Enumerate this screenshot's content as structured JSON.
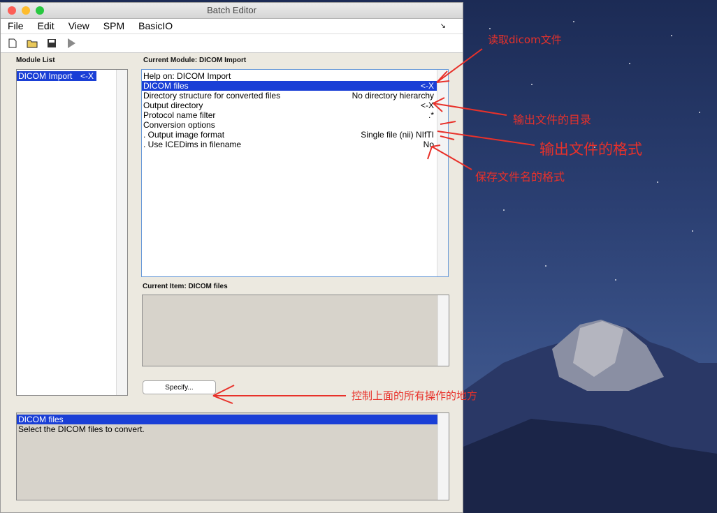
{
  "window": {
    "title": "Batch Editor"
  },
  "menu": [
    "File",
    "Edit",
    "View",
    "SPM",
    "BasicIO"
  ],
  "toolbar": {
    "icons": [
      "new-file-icon",
      "open-folder-icon",
      "save-icon",
      "run-icon"
    ]
  },
  "module_list": {
    "label": "Module List",
    "items": [
      {
        "name": "DICOM Import",
        "marker": "<-X"
      }
    ]
  },
  "current_module": {
    "label": "Current Module: DICOM Import",
    "rows": [
      {
        "name": "Help on: DICOM Import",
        "value": ""
      },
      {
        "name": "DICOM files",
        "value": "<-X"
      },
      {
        "name": "Directory structure for converted files",
        "value": "No directory hierarchy"
      },
      {
        "name": "Output directory",
        "value": "<-X"
      },
      {
        "name": "Protocol name filter",
        "value": ".*"
      },
      {
        "name": "Conversion options",
        "value": ""
      },
      {
        "name": " . Output image format",
        "value": "Single file (nii) NIfTI"
      },
      {
        "name": " . Use ICEDims in filename",
        "value": "No"
      }
    ]
  },
  "current_item": {
    "label": "Current Item: DICOM files"
  },
  "specify_button": "Specify...",
  "help": {
    "title": "DICOM files",
    "text": "Select the DICOM files to convert."
  },
  "annotations": {
    "read_dicom": "读取dicom文件",
    "output_dir": "输出文件的目录",
    "output_format": "输出文件的格式",
    "filename_format": "保存文件名的格式",
    "control_all": "控制上面的所有操作的地方"
  },
  "colors": {
    "selection": "#1a3fd6",
    "annotation": "#e8312a"
  }
}
